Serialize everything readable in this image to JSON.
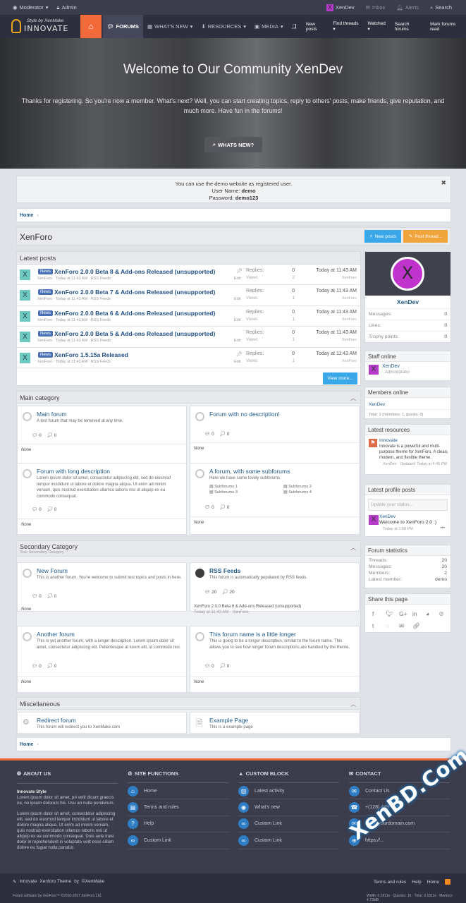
{
  "topbar": {
    "moderator": "Moderator",
    "admin": "Admin",
    "user": "XenDev",
    "inbox": "Inbox",
    "alerts": "Alerts",
    "search": "Search"
  },
  "logo": {
    "tagline": "Style by XenMake",
    "name": "INNOVATE"
  },
  "nav": {
    "tabs": [
      "FORUMS",
      "WHAT'S NEW",
      "RESOURCES",
      "MEDIA",
      "ME"
    ],
    "subnav": [
      "New posts",
      "Find threads",
      "Watched",
      "Search forums",
      "Mark forums read"
    ]
  },
  "hero": {
    "title": "Welcome to Our Community XenDev",
    "text": "Thanks for registering. So you're now a member. What's next? Well, you can start creating topics, reply to others' posts, make friends, give reputation, and much more. Have fun in the forums!",
    "button": "WHATS NEW?"
  },
  "notice": {
    "line1": "You can use the demo website as registered user.",
    "user_label": "User Name:",
    "user": "demo",
    "pass_label": "Password:",
    "pass": "demo123"
  },
  "breadcrumb": {
    "home": "Home"
  },
  "page": {
    "title": "XenForo",
    "new_posts": "New posts",
    "post_thread": "Post thread..."
  },
  "latest": {
    "title": "Latest posts",
    "replies": "Replies:",
    "views": "Views:",
    "date": "Today at 11:43 AM",
    "user": "XenForo",
    "edit": "Edit",
    "tag": "News",
    "view_more": "View more...",
    "items": [
      {
        "title": "XenForo 2.0.0 Beta 8 & Add-ons Released (unsupported)",
        "meta": "XenForo · Today at 11:43 AM · RSS Feeds",
        "replies": "0",
        "views": "2",
        "pin": true
      },
      {
        "title": "XenForo 2.0.0 Beta 7 & Add-ons Released (unsupported)",
        "meta": "XenForo · Today at 11:43 AM · RSS Feeds",
        "replies": "0",
        "views": "1",
        "pin": false
      },
      {
        "title": "XenForo 2.0.0 Beta 6 & Add-ons Released (unsupported)",
        "meta": "XenForo · Today at 11:43 AM · RSS Feeds",
        "replies": "0",
        "views": "1",
        "pin": false
      },
      {
        "title": "XenForo 2.0.0 Beta 5 & Add-ons Released (unsupported)",
        "meta": "XenForo · Today at 11:43 AM · RSS Feeds",
        "replies": "0",
        "views": "1",
        "pin": false
      },
      {
        "title": "XenForo 1.5.15a Released",
        "meta": "XenForo · Today at 11:43 AM · RSS Feeds",
        "replies": "0",
        "views": "1",
        "pin": true
      }
    ]
  },
  "main": {
    "title": "Main category",
    "f1": {
      "name": "Main forum",
      "desc": "A test forum that may be removed at any time.",
      "t": "0",
      "m": "0",
      "last": "None"
    },
    "f2": {
      "name": "Forum with no description!",
      "t": "0",
      "m": "0",
      "last": "None"
    },
    "f3": {
      "name": "Forum with long description",
      "desc": "Lorem ipsum dolor sit amet, consectetur adipiscing elit, sed do eiusmod tempor incididunt ut labore et dolore magna aliqua. Ut enim ad minim veniam, quis nostrud exercitation ullamco laboris nisi ut aliquip ex ea commodo consequat.",
      "t": "0",
      "m": "0",
      "last": "None"
    },
    "f4": {
      "name": "A forum, with some subforums",
      "desc": "Here we have some lovely subforums",
      "subs": [
        "Subforums 1",
        "Subforums 2",
        "Subforums 3",
        "Subforums 4"
      ],
      "t": "0",
      "m": "0",
      "last": "None"
    }
  },
  "secondary": {
    "title": "Secondary Category",
    "subtitle": "Your Secondary Category",
    "f1": {
      "name": "New Forum",
      "desc": "This is another forum. You're welcome to submit test topics and posts in here.",
      "t": "0",
      "m": "0",
      "last": "None"
    },
    "f2": {
      "name": "RSS Feeds",
      "desc": "This forum is automatically populated by RSS feeds.",
      "t": "20",
      "m": "20",
      "last": "XenForo 2.0.0 Beta 8 & Add-ons Released (unsupported)",
      "last_meta": "Today at 11:43 AM · XenForo"
    },
    "f3": {
      "name": "Another forum",
      "desc": "This is yet another forum, with a longer description. Lorem ipsum dolor sit amet, consectetur adipiscing elit. Pellentesque at lorem elit, id commodo nisi.",
      "t": "0",
      "m": "0",
      "last": "None"
    },
    "f4": {
      "name": "This forum name is a little longer",
      "desc": "This is going to be a longer description, similar to the forum name. This allows you to see how longer forum descriptions are handled by the theme.",
      "t": "0",
      "m": "0",
      "last": "None"
    }
  },
  "misc": {
    "title": "Miscellaneous",
    "f1": {
      "name": "Redirect forum",
      "desc": "This forum will redirect you to XenMake.com"
    },
    "f2": {
      "name": "Example Page",
      "desc": "This is a example page"
    }
  },
  "sidebar": {
    "profile": {
      "name": "XenDev",
      "messages_l": "Messages:",
      "messages": "0",
      "likes_l": "Likes:",
      "likes": "0",
      "trophy_l": "Trophy points:",
      "trophy": "0"
    },
    "staff": {
      "title": "Staff online",
      "name": "XenDev",
      "role": "Administrator"
    },
    "members": {
      "title": "Members online",
      "name": "XenDev",
      "total": "Total: 1 (members: 1, guests: 0)"
    },
    "resources": {
      "title": "Latest resources",
      "name": "Innovate",
      "desc": "Innovate is a powerful and multi-purpose theme for XenForo. A clean, modern, and flexible theme.",
      "meta": "XenDev · Updated: Today at 4:45 PM"
    },
    "profileposts": {
      "title": "Latest profile posts",
      "placeholder": "Update your status...",
      "name": "XenDev",
      "text": "Welcome to XenForo 2.0 :)",
      "meta": "Today at 1:58 PM",
      "more": "•••"
    },
    "stats": {
      "title": "Forum statistics",
      "threads_l": "Threads:",
      "threads": "20",
      "messages_l": "Messages:",
      "messages": "20",
      "members_l": "Members:",
      "members": "2",
      "latest_l": "Latest member:",
      "latest": "demo"
    },
    "share": {
      "title": "Share this page"
    }
  },
  "footer": {
    "about": {
      "title": "ABOUT US",
      "heading": "Innovate Style",
      "p1": "Lorem ipsum dolor sit amet, pri velit dicant graecis ne, no ipsum dolorem his. Usu an nulla ponderum.",
      "p2": "Lorem ipsum dolor sit amet, consectetur adipiscing elit, sed do eiusmod tempor incididunt ut labore et dolore magna aliqua. Ut enim ad minim veniam, quis nostrud exercitation ullamco laboris nisi ut aliquip ex ea commodo consequat. Duis aute irure dolor in reprehenderit in voluptate velit esse cillum dolore eu fugiat nulla pariatur."
    },
    "site": {
      "title": "SITE FUNCTIONS",
      "links": [
        "Home",
        "Terms and rules",
        "Help",
        "Custom Link"
      ]
    },
    "custom": {
      "title": "CUSTOM BLOCK",
      "links": [
        "Latest activity",
        "What's new",
        "Custom Link",
        "Custom Link"
      ]
    },
    "contact": {
      "title": "CONTACT",
      "links": [
        "Contact Us",
        "+(128) 449-7881",
        "info@yourdomain.com",
        "https://..."
      ]
    }
  },
  "bottom": {
    "theme": "Innovate",
    "theme2": "Xenforo Theme",
    "by": "by",
    "maker": "©XenMake",
    "software": "Forum software by XenForo™ ©2010-2017 XenForo Ltd.",
    "links": [
      "Terms and rules",
      "Help",
      "Home"
    ],
    "stats": "Width: 0.1911s · Queries: 16 · Time: 0.1911s · Memory: 4.73MB"
  },
  "watermark": "XenBD.Com"
}
